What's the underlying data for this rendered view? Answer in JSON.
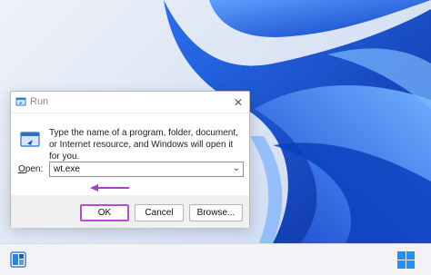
{
  "dialog": {
    "title": "Run",
    "close_glyph": "✕",
    "description": "Type the name of a program, folder, document, or Internet resource, and Windows will open it for you.",
    "open_label_accel": "O",
    "open_label_rest": "pen:",
    "open_value": "wt.exe",
    "buttons": {
      "ok": "OK",
      "cancel": "Cancel",
      "browse": "Browse..."
    }
  },
  "annotation": {
    "arrow_color": "#a540c9",
    "highlight_color": "#b94ad8"
  },
  "taskbar": {
    "icons": [
      "widgets-icon",
      "windows-start-icon"
    ]
  },
  "colors": {
    "wallpaper_blue": "#1b5de0",
    "wallpaper_light": "#3f86f5"
  }
}
